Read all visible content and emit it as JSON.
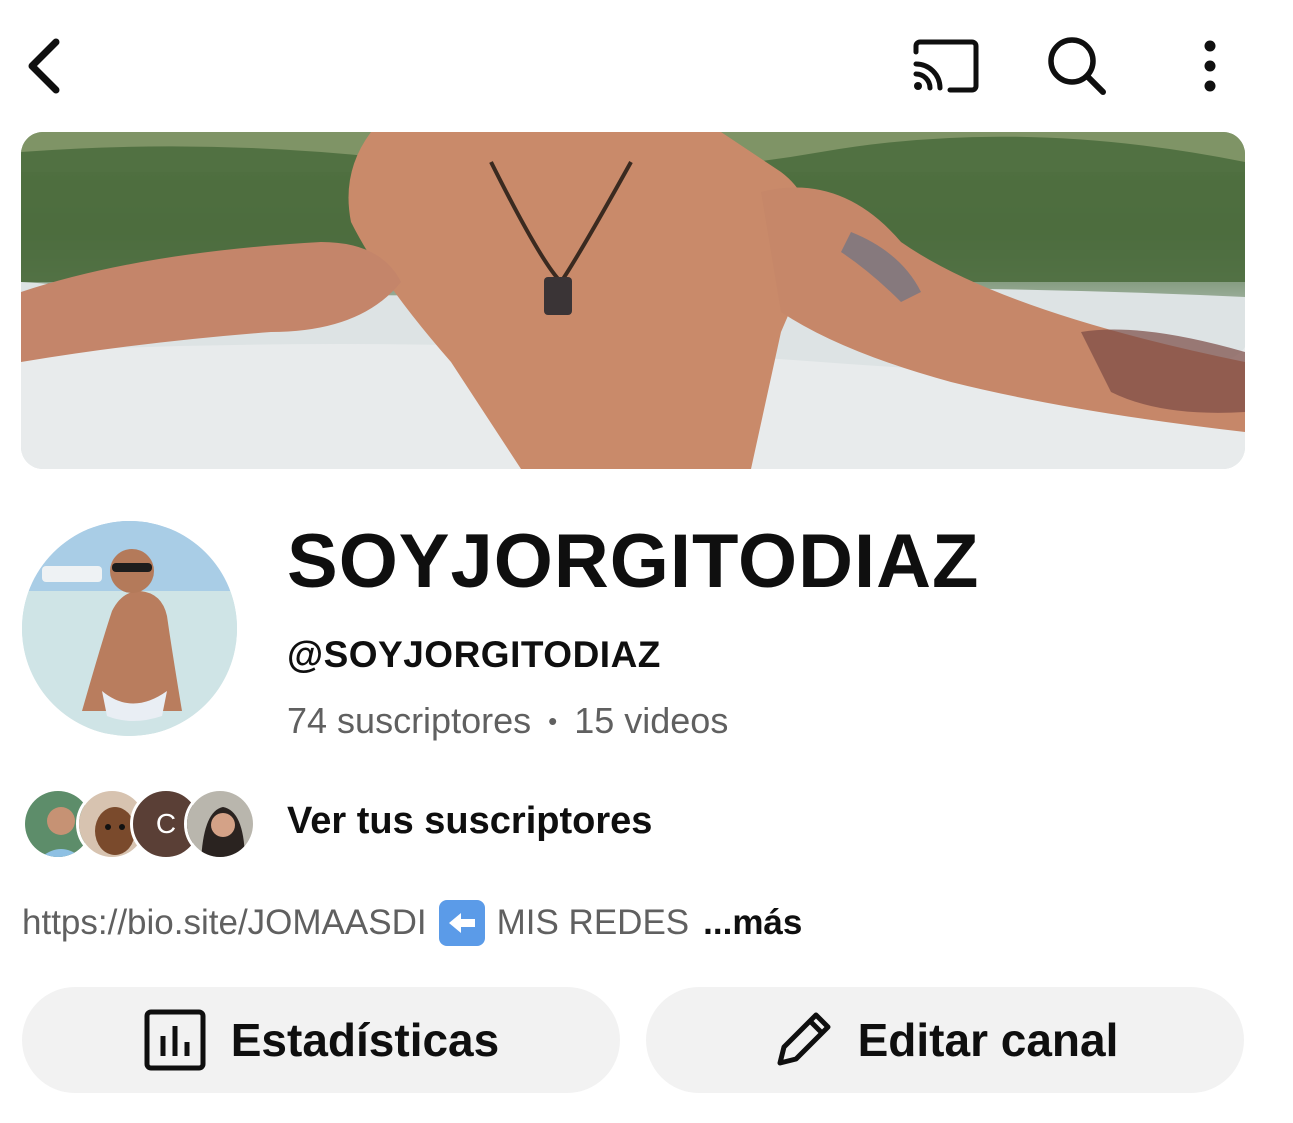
{
  "header": {
    "back_icon": "chevron-left-icon",
    "cast_icon": "cast-icon",
    "search_icon": "search-icon",
    "more_icon": "more-vert-icon"
  },
  "channel": {
    "name": "SOYJORGITODIAZ",
    "handle": "@SOYJORGITODIAZ",
    "subscribers": "74 suscriptores",
    "separator": "•",
    "videos": "15 videos"
  },
  "subscribers_row": {
    "avatar_initial": "C",
    "link_label": "Ver tus suscriptores"
  },
  "bio": {
    "link": "https://bio.site/JOMAASDI",
    "emoji": "⬅️",
    "text": "MIS REDES",
    "more_label": "...más"
  },
  "actions": {
    "stats_label": "Estadísticas",
    "edit_label": "Editar canal"
  },
  "colors": {
    "text_primary": "#0f0f0f",
    "text_secondary": "#606060",
    "button_bg": "#f2f2f2"
  }
}
